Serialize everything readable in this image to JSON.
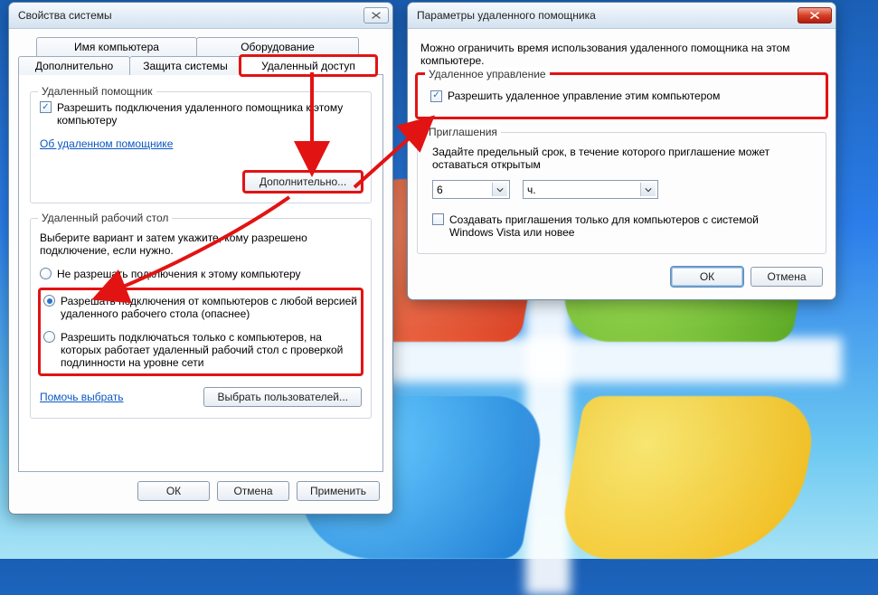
{
  "win1": {
    "title": "Свойства системы",
    "tabs": {
      "row1": [
        "Имя компьютера",
        "Оборудование"
      ],
      "row2": [
        "Дополнительно",
        "Защита системы",
        "Удаленный доступ"
      ],
      "active": "Удаленный доступ"
    },
    "ra_group_title": "Удаленный помощник",
    "ra_checkbox": "Разрешить подключения удаленного помощника к этому компьютеру",
    "ra_link": "Об удаленном помощнике",
    "ra_advanced_btn": "Дополнительно...",
    "rd_group_title": "Удаленный рабочий стол",
    "rd_instruction": "Выберите вариант и затем укажите, кому разрешено подключение, если нужно.",
    "rd_opt1": "Не разрешать подключения к этому компьютеру",
    "rd_opt2": "Разрешать подключения от компьютеров с любой версией удаленного рабочего стола (опаснее)",
    "rd_opt3": "Разрешить подключаться только с компьютеров, на которых работает удаленный рабочий стол с проверкой подлинности на уровне сети",
    "rd_help_link": "Помочь выбрать",
    "rd_users_btn": "Выбрать пользователей...",
    "btn_ok": "ОК",
    "btn_cancel": "Отмена",
    "btn_apply": "Применить"
  },
  "win2": {
    "title": "Параметры удаленного помощника",
    "intro": "Можно ограничить время использования удаленного помощника на этом компьютере.",
    "rc_group_title": "Удаленное управление",
    "rc_checkbox": "Разрешить удаленное управление этим компьютером",
    "inv_group_title": "Приглашения",
    "inv_instruction": "Задайте предельный срок, в течение которого приглашение может оставаться открытым",
    "inv_value": "6",
    "inv_unit": "ч.",
    "inv_vista_checkbox": "Создавать приглашения только для компьютеров с системой Windows Vista или новее",
    "btn_ok": "ОК",
    "btn_cancel": "Отмена"
  },
  "colors": {
    "highlight": "#e21313"
  }
}
